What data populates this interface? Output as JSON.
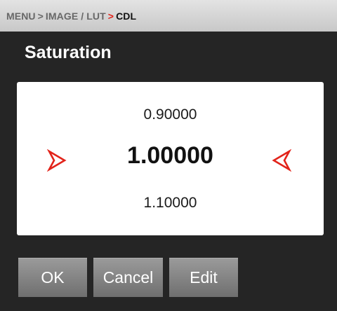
{
  "breadcrumb": {
    "menu": "MENU",
    "separator": ">",
    "section": "IMAGE / LUT",
    "current": "CDL"
  },
  "title": "Saturation",
  "picker": {
    "previous_value": "0.90000",
    "current_value": "1.00000",
    "next_value": "1.10000"
  },
  "buttons": {
    "ok": "OK",
    "cancel": "Cancel",
    "edit": "Edit"
  },
  "colors": {
    "accent_red": "#e2231a",
    "background": "#252525",
    "button": "#7f7f7f"
  },
  "icons": {
    "left_arrow": "chevron-right-icon",
    "right_arrow": "chevron-left-icon"
  }
}
